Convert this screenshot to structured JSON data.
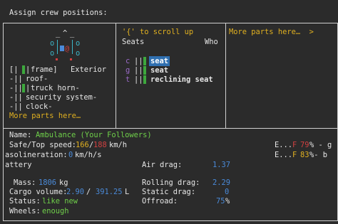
{
  "window": {
    "title": "Assign crew positions:"
  },
  "parts_panel": {
    "diagram": {
      "top_glyphs": [
        "_",
        "^",
        "_"
      ],
      "side_glyphs": [
        "o",
        "o",
        "o",
        "o"
      ],
      "center_glyph": "@"
    },
    "rows": [
      {
        "prefix": "[|",
        "mid": "|",
        "label": "frame]",
        "extra": "Exterior"
      },
      {
        "prefix": "-||",
        "label": "roof-"
      },
      {
        "prefix": "-||",
        "mid": "|",
        "label": "truck horn-"
      },
      {
        "prefix": "-||",
        "label": "security system-"
      },
      {
        "prefix": "-||",
        "label": "clock-"
      }
    ],
    "more": "More parts here…"
  },
  "seats_panel": {
    "scroll_hint": "'{' to scroll up",
    "col_seats": "Seats",
    "col_who": "Who",
    "rows": [
      {
        "key": "c",
        "marker": "||",
        "label": "seat",
        "selected": true
      },
      {
        "key": "g",
        "marker": "||",
        "label": "seat",
        "selected": false
      },
      {
        "key": "t",
        "marker": "||",
        "label": "reclining seat",
        "selected": false
      }
    ]
  },
  "more_panel": {
    "label": "More parts here…  >"
  },
  "vehicle": {
    "name_label": "Name:",
    "name_value": "Ambulance (Your Followers)",
    "speed_label": "Safe/Top speed:",
    "safe_speed": "166",
    "top_speed": "188",
    "speed_unit": "km/h",
    "accel_label": "asolineration:",
    "accel_value": "0",
    "accel_unit": "km/h/s",
    "battery_label": "attery",
    "air_drag_label": "Air drag:",
    "air_drag_value": "1.37",
    "mass_label": "Mass:",
    "mass_value": "1806",
    "mass_unit": "kg",
    "rolling_drag_label": "Rolling drag:",
    "rolling_drag_value": "2.29",
    "cargo_label": "Cargo volume:",
    "cargo_used": "2.90",
    "cargo_total": "391.25",
    "cargo_unit": "L",
    "static_drag_label": "Static drag:",
    "static_drag_value": "0",
    "status_label": "Status:",
    "status_value": "like new",
    "offroad_label": "Offroad:",
    "offroad_value": "75",
    "offroad_unit": "%",
    "wheels_label": "Wheels:",
    "wheels_value": "enough",
    "fuel1": {
      "e": "E...",
      "f": "F",
      "pct": "79",
      "tail": "% - g"
    },
    "fuel2": {
      "e": "E...",
      "f": "F",
      "pct": "83",
      "tail": "%- b"
    }
  }
}
